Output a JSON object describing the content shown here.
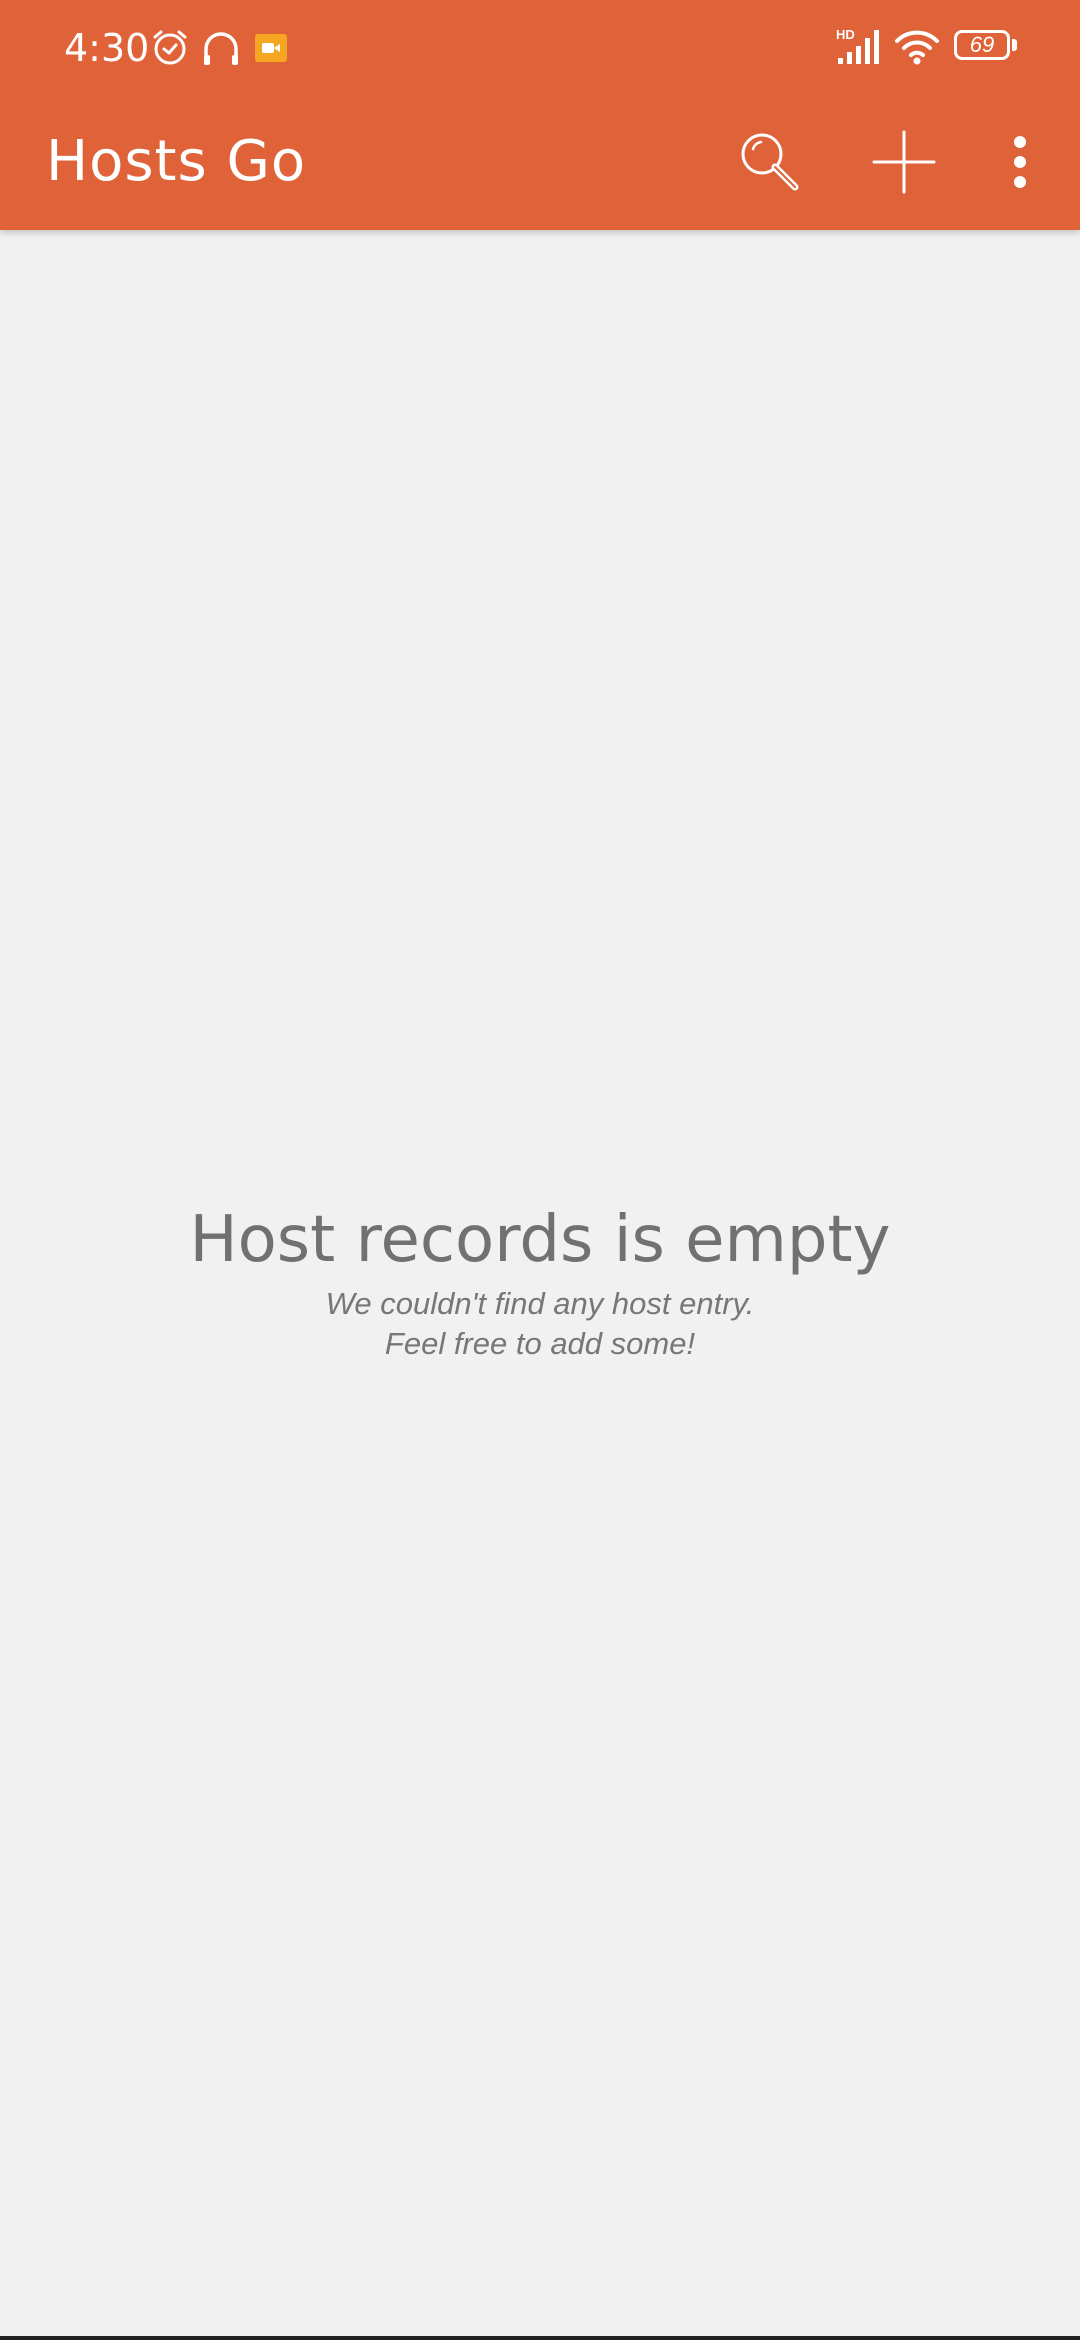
{
  "status_bar": {
    "time": "4:30",
    "network_badge": "HD",
    "battery_level": "69",
    "icons": [
      "alarm-icon",
      "headphones-icon",
      "video-record-icon",
      "signal-icon",
      "wifi-icon",
      "battery-icon"
    ]
  },
  "app_bar": {
    "title": "Hosts Go",
    "actions": [
      "search-icon",
      "add-icon",
      "more-vert-icon"
    ],
    "color": "#e06238"
  },
  "empty_state": {
    "title": "Host records is empty",
    "line1": "We couldn't find any host entry.",
    "line2": "Feel free to add some!"
  }
}
